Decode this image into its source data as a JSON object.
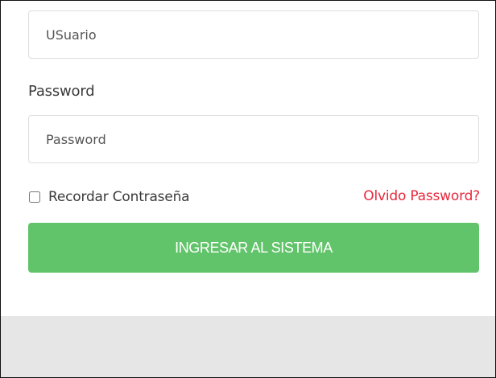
{
  "login_form": {
    "username_placeholder": "USuario",
    "password_label": "Password",
    "password_placeholder": "Password",
    "remember_label": "Recordar Contraseña",
    "remember_checked": false,
    "forgot_link": "Olvido Password?",
    "submit_label": "INGRESAR AL SISTEMA"
  },
  "colors": {
    "submit_button": "#62c46a",
    "forgot_link": "#e8283c",
    "footer_band": "#e6e6e6"
  }
}
